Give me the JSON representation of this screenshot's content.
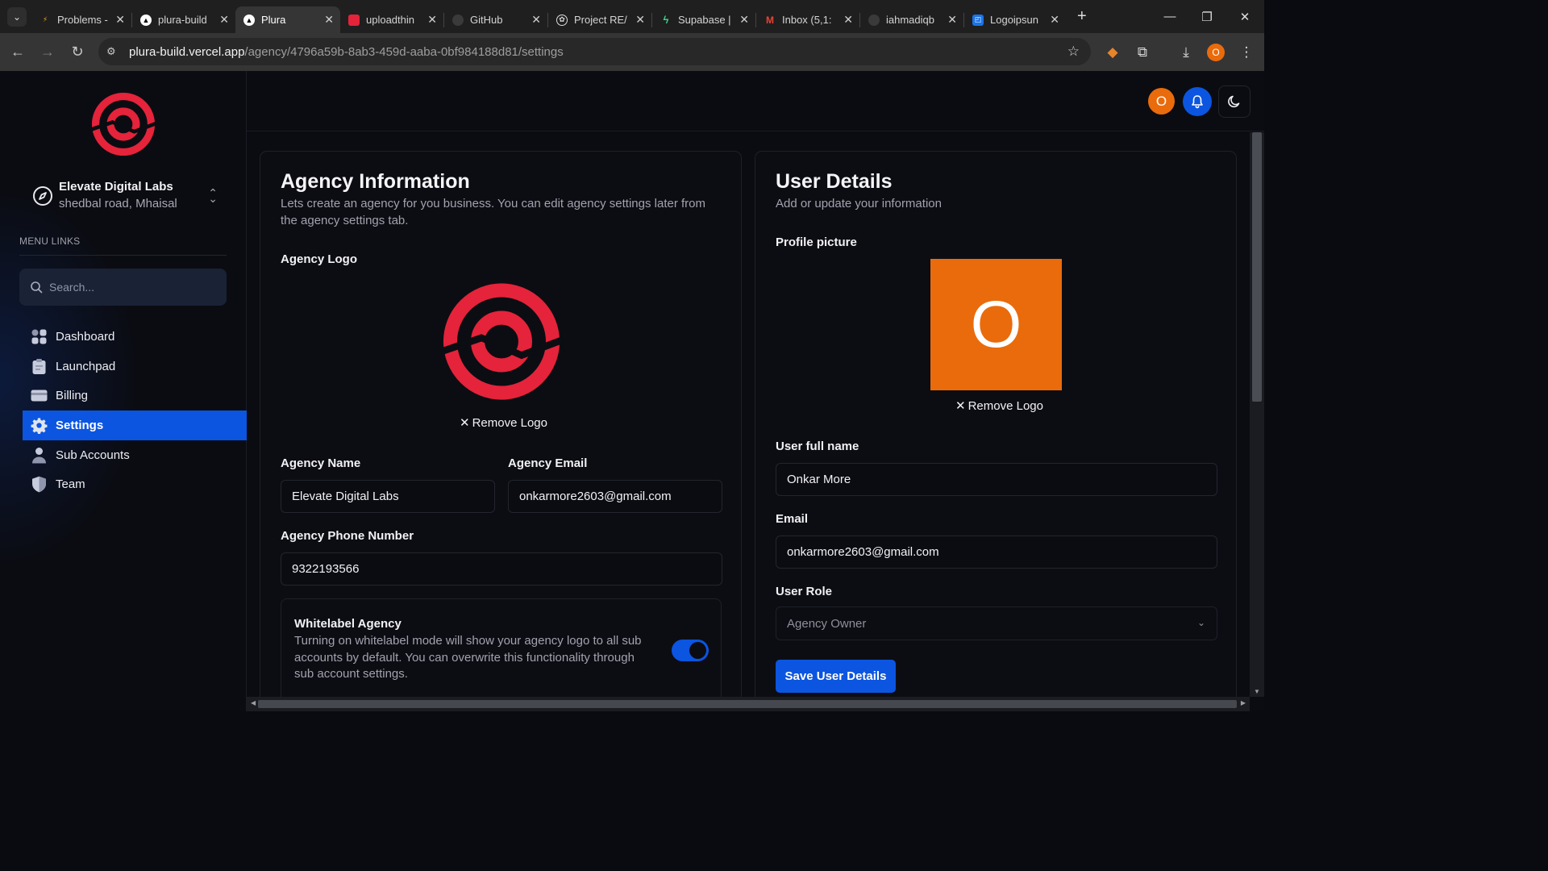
{
  "browser": {
    "tabs": [
      {
        "title": "Problems -",
        "favicon": "flame-icon"
      },
      {
        "title": "plura-build",
        "favicon": "vercel-icon"
      },
      {
        "title": "Plura",
        "favicon": "vercel-icon",
        "active": true
      },
      {
        "title": "uploadthin",
        "favicon": "uploadthing-icon"
      },
      {
        "title": "GitHub",
        "favicon": "github-icon"
      },
      {
        "title": "Project RE/",
        "favicon": "openai-icon"
      },
      {
        "title": "Supabase |",
        "favicon": "supabase-icon"
      },
      {
        "title": "Inbox (5,1:",
        "favicon": "gmail-icon"
      },
      {
        "title": "iahmadiqb",
        "favicon": "github-icon"
      },
      {
        "title": "Logoipsun",
        "favicon": "logoipsum-icon"
      }
    ],
    "url_host": "plura-build.vercel.app",
    "url_path": "/agency/4796a59b-8ab3-459d-aaba-0bf984188d81/settings",
    "profile_initial": "O"
  },
  "sidebar": {
    "agency_name": "Elevate Digital Labs",
    "agency_address": "shedbal road, Mhaisal",
    "menu_heading": "MENU LINKS",
    "search_placeholder": "Search...",
    "items": [
      {
        "label": "Dashboard",
        "icon": "dashboard-icon"
      },
      {
        "label": "Launchpad",
        "icon": "clipboard-icon"
      },
      {
        "label": "Billing",
        "icon": "card-icon"
      },
      {
        "label": "Settings",
        "icon": "gear-icon",
        "active": true
      },
      {
        "label": "Sub Accounts",
        "icon": "person-icon"
      },
      {
        "label": "Team",
        "icon": "shield-icon"
      }
    ]
  },
  "topbar": {
    "avatar_initial": "O"
  },
  "agency_card": {
    "title": "Agency Information",
    "subtitle": "Lets create an agency for you business. You can edit agency settings later from the agency settings tab.",
    "logo_label": "Agency Logo",
    "remove_logo": "Remove Logo",
    "name_label": "Agency Name",
    "name_value": "Elevate Digital Labs",
    "email_label": "Agency Email",
    "email_value": "onkarmore2603@gmail.com",
    "phone_label": "Agency Phone Number",
    "phone_value": "9322193566",
    "whitelabel_title": "Whitelabel Agency",
    "whitelabel_desc": "Turning on whitelabel mode will show your agency logo to all sub accounts by default. You can overwrite this functionality through sub account settings.",
    "whitelabel_on": true
  },
  "user_card": {
    "title": "User Details",
    "subtitle": "Add or update your information",
    "picture_label": "Profile picture",
    "picture_initial": "O",
    "remove_logo": "Remove Logo",
    "fullname_label": "User full name",
    "fullname_value": "Onkar More",
    "email_label": "Email",
    "email_value": "onkarmore2603@gmail.com",
    "role_label": "User Role",
    "role_value": "Agency Owner",
    "save_label": "Save User Details"
  },
  "colors": {
    "accent": "#0b55e0",
    "avatar": "#ea6b0b",
    "logo_red": "#e5233a"
  }
}
